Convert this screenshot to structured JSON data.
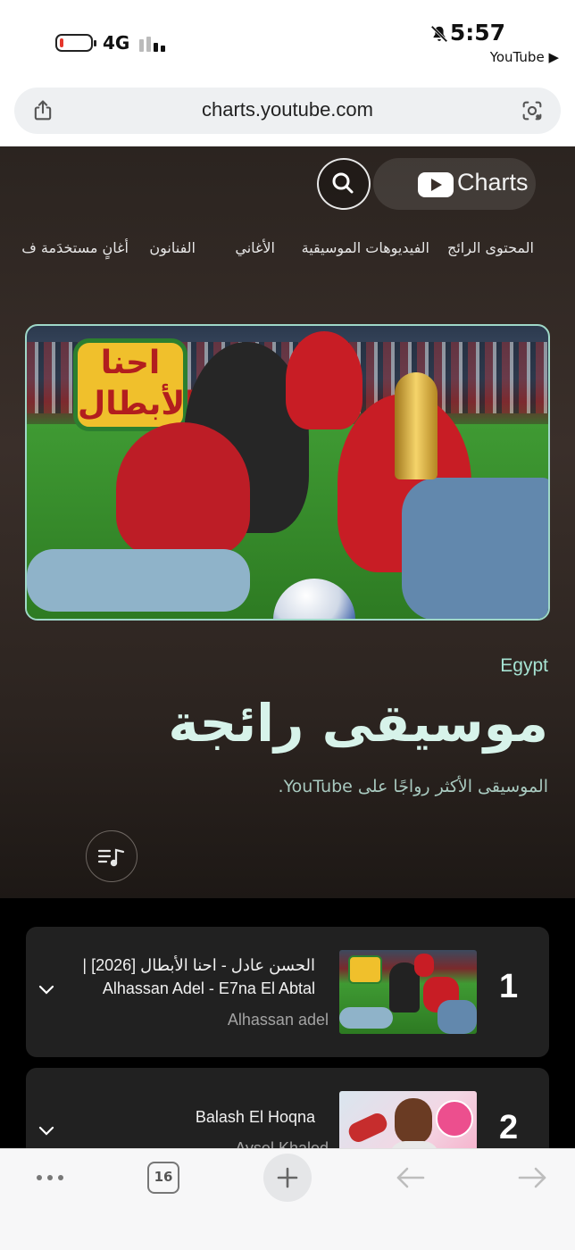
{
  "status_bar": {
    "network": "4G",
    "time": "5:57",
    "back_to_app": "YouTube ▶"
  },
  "browser": {
    "url": "charts.youtube.com",
    "tab_count": "16"
  },
  "header": {
    "logo_text": "Charts"
  },
  "nav": {
    "items": [
      {
        "label": "المحتوى الرائج"
      },
      {
        "label": "الفيديوهات الموسيقية"
      },
      {
        "label": "الأغاني"
      },
      {
        "label": "الفنانون"
      },
      {
        "label": "أغانٍ مستخدَمة ف"
      }
    ]
  },
  "banner": {
    "title_art": "احنا الأبطال"
  },
  "hero": {
    "country": "Egypt",
    "title": "موسيقى رائجة",
    "subtitle": "الموسيقى الأكثر رواجًا على YouTube."
  },
  "chart_list": [
    {
      "rank": "1",
      "title_line1": "الحسن عادل - احنا الأبطال [2026] |",
      "title_line2": "Alhassan Adel - E7na El Abtal",
      "artist": "Alhassan adel"
    },
    {
      "rank": "2",
      "title_line1": "",
      "title_line2": "Balash El Hoqna",
      "artist": "Aysel Khaled"
    }
  ],
  "colors": {
    "accent_mint": "#a6e3d3",
    "heading": "#d7f3ea",
    "card_bg": "#212121",
    "page_bg": "#3a2f2a"
  }
}
